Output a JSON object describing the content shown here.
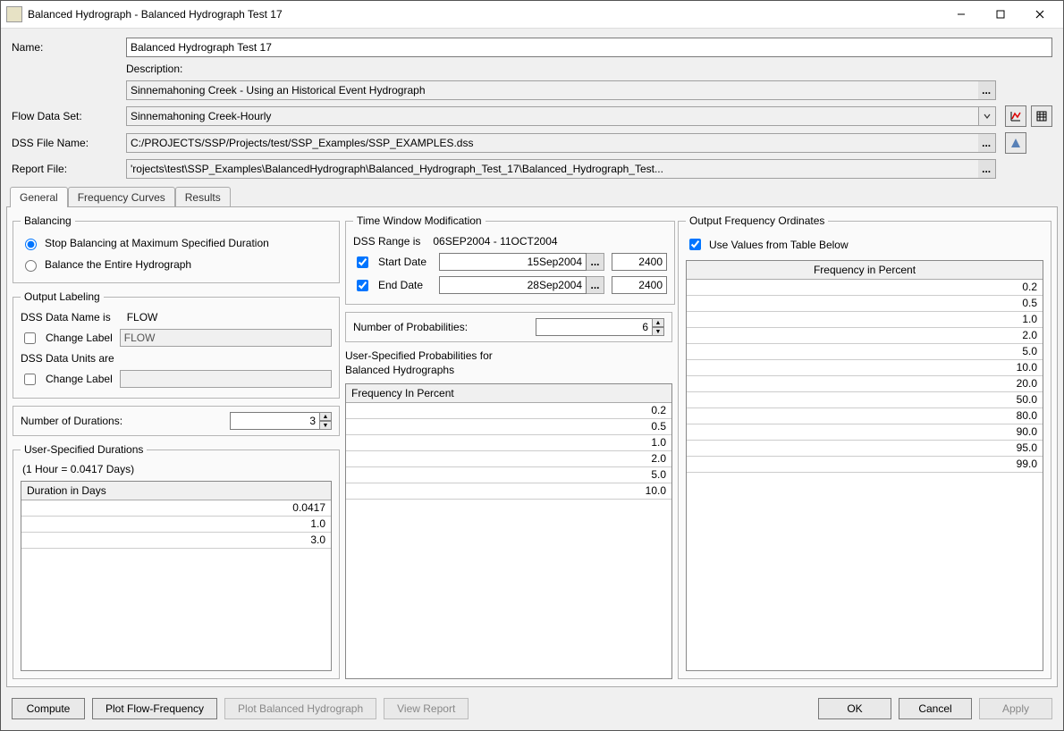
{
  "window": {
    "title": "Balanced Hydrograph -  Balanced Hydrograph Test 17"
  },
  "form": {
    "name_label": "Name:",
    "name_value": "Balanced Hydrograph Test 17",
    "desc_label": "Description:",
    "desc_value": "Sinnemahoning Creek - Using an Historical Event Hydrograph",
    "flowset_label": "Flow Data Set:",
    "flowset_value": "Sinnemahoning Creek-Hourly",
    "dssfile_label": "DSS File Name:",
    "dssfile_value": "C:/PROJECTS/SSP/Projects/test/SSP_Examples/SSP_EXAMPLES.dss",
    "report_label": "Report File:",
    "report_value": "'rojects\\test\\SSP_Examples\\BalancedHydrograph\\Balanced_Hydrograph_Test_17\\Balanced_Hydrograph_Test..."
  },
  "tabs": {
    "general": "General",
    "freqcurves": "Frequency Curves",
    "results": "Results"
  },
  "balancing": {
    "legend": "Balancing",
    "opt1": "Stop Balancing at Maximum Specified Duration",
    "opt2": "Balance the Entire Hydrograph"
  },
  "output_labeling": {
    "legend": "Output Labeling",
    "dss_name_lbl": "DSS Data Name is",
    "dss_name_val": "FLOW",
    "change_label": "Change Label",
    "change_val1": "FLOW",
    "dss_units_lbl": "DSS Data Units are",
    "change_val2": ""
  },
  "num_durations_label": "Number of Durations:",
  "num_durations_value": "3",
  "user_durations": {
    "legend": "User-Specified Durations",
    "note": "(1 Hour = 0.0417 Days)",
    "header": "Duration in Days",
    "rows": [
      "0.0417",
      "1.0",
      "3.0"
    ]
  },
  "time_window": {
    "legend": "Time Window Modification",
    "range_lbl": "DSS Range is",
    "range_val": "06SEP2004 - 11OCT2004",
    "start_lbl": "Start Date",
    "start_date": "15Sep2004",
    "start_time": "2400",
    "end_lbl": "End Date",
    "end_date": "28Sep2004",
    "end_time": "2400"
  },
  "num_prob_label": "Number of Probabilities:",
  "num_prob_value": "6",
  "user_probs": {
    "title1": "User-Specified Probabilities for",
    "title2": "Balanced Hydrographs",
    "header": "Frequency In Percent",
    "rows": [
      "0.2",
      "0.5",
      "1.0",
      "2.0",
      "5.0",
      "10.0"
    ]
  },
  "output_freq": {
    "legend": "Output Frequency Ordinates",
    "chk_label": "Use Values from Table Below",
    "header": "Frequency in Percent",
    "rows": [
      "0.2",
      "0.5",
      "1.0",
      "2.0",
      "5.0",
      "10.0",
      "20.0",
      "50.0",
      "80.0",
      "90.0",
      "95.0",
      "99.0"
    ]
  },
  "buttons": {
    "compute": "Compute",
    "plot_ff": "Plot Flow-Frequency",
    "plot_bh": "Plot Balanced Hydrograph",
    "view_report": "View Report",
    "ok": "OK",
    "cancel": "Cancel",
    "apply": "Apply"
  },
  "ellipsis": "..."
}
